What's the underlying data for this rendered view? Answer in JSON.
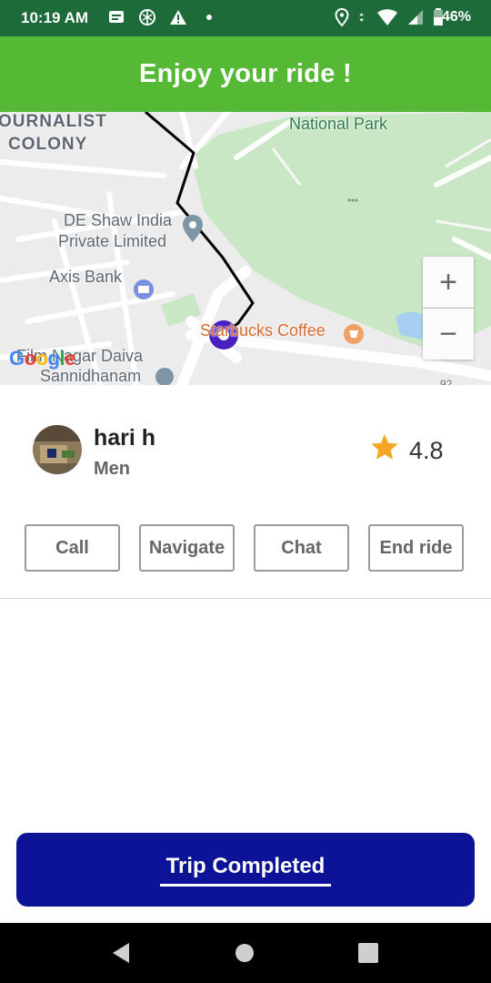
{
  "status_bar": {
    "time": "10:19 AM",
    "battery": "46%",
    "icons_left": [
      "message-icon",
      "target-icon",
      "warning-icon",
      "dot-icon"
    ],
    "icons_right": [
      "location-icon",
      "data-arrows-icon",
      "wifi-icon",
      "signal-icon",
      "battery-icon"
    ]
  },
  "header": {
    "title": "Enjoy your ride !"
  },
  "map": {
    "labels": {
      "national_park": "National Park",
      "journalist_1": "OURNALIST",
      "journalist_2": "COLONY",
      "deshaw_1": "DE Shaw India",
      "deshaw_2": "Private Limited",
      "axis_bank": "Axis Bank",
      "starbucks": "Starbucks Coffee",
      "film_nagar_1": "Film Nagar Daiva",
      "film_nagar_2": "Sannidhanam",
      "road_number": "92"
    },
    "zoom_in": "+",
    "zoom_out": "−",
    "attribution": "Google",
    "colors": {
      "park": "#c9e7c4",
      "route": "#000000",
      "marker": "#4a1fc1",
      "water": "#a6cff2"
    }
  },
  "driver": {
    "name": "hari h",
    "gender": "Men",
    "rating": "4.8",
    "star_color": "#f5a623"
  },
  "actions": {
    "call": "Call",
    "navigate": "Navigate",
    "chat": "Chat",
    "end_ride": "End ride"
  },
  "footer": {
    "trip_button": "Trip Completed",
    "button_color": "#0d1396"
  },
  "navbar": {
    "icons": [
      "back-icon",
      "home-icon",
      "recents-icon"
    ]
  }
}
